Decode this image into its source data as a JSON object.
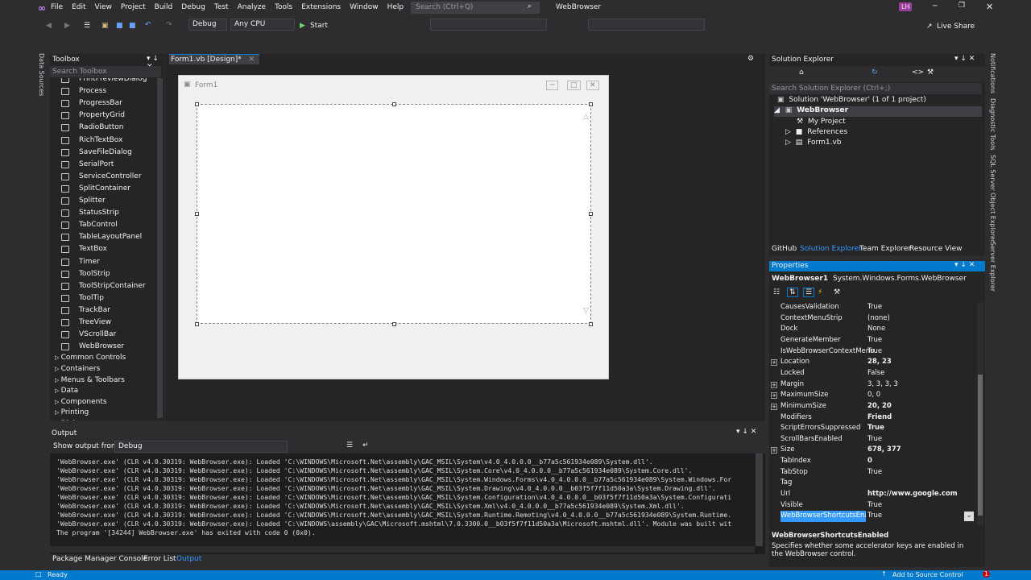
{
  "menu": [
    "File",
    "Edit",
    "View",
    "Project",
    "Build",
    "Debug",
    "Test",
    "Analyze",
    "Tools",
    "Extensions",
    "Window",
    "Help"
  ],
  "search_placeholder": "Search (Ctrl+Q)",
  "window_title": "WebBrowser",
  "user_initials": "LH",
  "toolbar": {
    "config": "Debug",
    "platform": "Any CPU",
    "start": "Start",
    "live_share": "Live Share"
  },
  "toolbox": {
    "title": "Toolbox",
    "search": "Search Toolbox",
    "items": [
      "PrintPreviewDialog",
      "Process",
      "ProgressBar",
      "PropertyGrid",
      "RadioButton",
      "RichTextBox",
      "SaveFileDialog",
      "SerialPort",
      "ServiceController",
      "SplitContainer",
      "Splitter",
      "StatusStrip",
      "TabControl",
      "TableLayoutPanel",
      "TextBox",
      "Timer",
      "ToolStrip",
      "ToolStripContainer",
      "ToolTip",
      "TrackBar",
      "TreeView",
      "VScrollBar",
      "WebBrowser"
    ],
    "categories": [
      "Common Controls",
      "Containers",
      "Menus & Toolbars",
      "Data",
      "Components",
      "Printing",
      "Dialogs"
    ]
  },
  "design_tab": "Form1.vb [Design]*",
  "form_title": "Form1",
  "output": {
    "title": "Output",
    "show_from_label": "Show output from:",
    "source": "Debug",
    "lines": [
      "'WebBrowser.exe' (CLR v4.0.30319: WebBrowser.exe): Loaded 'C:\\WINDOWS\\Microsoft.Net\\assembly\\GAC_MSIL\\System\\v4.0_4.0.0.0__b77a5c561934e089\\System.dll'.",
      "'WebBrowser.exe' (CLR v4.0.30319: WebBrowser.exe): Loaded 'C:\\WINDOWS\\Microsoft.Net\\assembly\\GAC_MSIL\\System.Core\\v4.0_4.0.0.0__b77a5c561934e089\\System.Core.dll'.",
      "'WebBrowser.exe' (CLR v4.0.30319: WebBrowser.exe): Loaded 'C:\\WINDOWS\\Microsoft.Net\\assembly\\GAC_MSIL\\System.Windows.Forms\\v4.0_4.0.0.0__b77a5c561934e089\\System.Windows.For",
      "'WebBrowser.exe' (CLR v4.0.30319: WebBrowser.exe): Loaded 'C:\\WINDOWS\\Microsoft.Net\\assembly\\GAC_MSIL\\System.Drawing\\v4.0_4.0.0.0__b03f5f7f11d50a3a\\System.Drawing.dll'.",
      "'WebBrowser.exe' (CLR v4.0.30319: WebBrowser.exe): Loaded 'C:\\WINDOWS\\Microsoft.Net\\assembly\\GAC_MSIL\\System.Configuration\\v4.0_4.0.0.0__b03f5f7f11d50a3a\\System.Configurati",
      "'WebBrowser.exe' (CLR v4.0.30319: WebBrowser.exe): Loaded 'C:\\WINDOWS\\Microsoft.Net\\assembly\\GAC_MSIL\\System.Xml\\v4.0_4.0.0.0__b77a5c561934e089\\System.Xml.dll'.",
      "'WebBrowser.exe' (CLR v4.0.30319: WebBrowser.exe): Loaded 'C:\\WINDOWS\\Microsoft.Net\\assembly\\GAC_MSIL\\System.Runtime.Remoting\\v4.0_4.0.0.0__b77a5c561934e089\\System.Runtime.",
      "'WebBrowser.exe' (CLR v4.0.30319: WebBrowser.exe): Loaded 'C:\\WINDOWS\\assembly\\GAC\\Microsoft.mshtml\\7.0.3300.0__b03f5f7f11d50a3a\\Microsoft.mshtml.dll'. Module was built wit",
      "The program '[34244] WebBrowser.exe' has exited with code 0 (0x0)."
    ]
  },
  "bottom_tabs": [
    "Package Manager Console",
    "Error List",
    "Output"
  ],
  "solution_explorer": {
    "title": "Solution Explorer",
    "search": "Search Solution Explorer (Ctrl+;)",
    "solution": "Solution 'WebBrowser' (1 of 1 project)",
    "project": "WebBrowser",
    "nodes": [
      "My Project",
      "References",
      "Form1.vb"
    ],
    "tabs": [
      "GitHub",
      "Solution Explorer",
      "Team Explorer",
      "Resource View"
    ]
  },
  "properties": {
    "title": "Properties",
    "object": "WebBrowser1",
    "object_type": "System.Windows.Forms.WebBrowser",
    "rows": [
      {
        "name": "CausesValidation",
        "value": "True",
        "exp": false,
        "bold": false
      },
      {
        "name": "ContextMenuStrip",
        "value": "(none)",
        "exp": false,
        "bold": false
      },
      {
        "name": "Dock",
        "value": "None",
        "exp": false,
        "bold": false
      },
      {
        "name": "GenerateMember",
        "value": "True",
        "exp": false,
        "bold": false
      },
      {
        "name": "IsWebBrowserContextMenu",
        "value": "True",
        "exp": false,
        "bold": false
      },
      {
        "name": "Location",
        "value": "28, 23",
        "exp": true,
        "bold": true
      },
      {
        "name": "Locked",
        "value": "False",
        "exp": false,
        "bold": false
      },
      {
        "name": "Margin",
        "value": "3, 3, 3, 3",
        "exp": true,
        "bold": false
      },
      {
        "name": "MaximumSize",
        "value": "0, 0",
        "exp": true,
        "bold": false
      },
      {
        "name": "MinimumSize",
        "value": "20, 20",
        "exp": true,
        "bold": true
      },
      {
        "name": "Modifiers",
        "value": "Friend",
        "exp": false,
        "bold": true
      },
      {
        "name": "ScriptErrorsSuppressed",
        "value": "True",
        "exp": false,
        "bold": true
      },
      {
        "name": "ScrollBarsEnabled",
        "value": "True",
        "exp": false,
        "bold": false
      },
      {
        "name": "Size",
        "value": "678, 377",
        "exp": true,
        "bold": true
      },
      {
        "name": "TabIndex",
        "value": "0",
        "exp": false,
        "bold": true
      },
      {
        "name": "TabStop",
        "value": "True",
        "exp": false,
        "bold": false
      },
      {
        "name": "Tag",
        "value": "",
        "exp": false,
        "bold": false
      },
      {
        "name": "Url",
        "value": "http://www.google.com",
        "exp": false,
        "bold": true
      },
      {
        "name": "Visible",
        "value": "True",
        "exp": false,
        "bold": false
      },
      {
        "name": "WebBrowserShortcutsEnabl",
        "value": "True",
        "exp": false,
        "bold": false
      }
    ],
    "desc_title": "WebBrowserShortcutsEnabled",
    "desc_text": "Specifies whether some accelerator keys are enabled in the WebBrowser control."
  },
  "side_left": [
    "Data Sources"
  ],
  "side_right": [
    "Notifications",
    "Diagnostic Tools",
    "SQL Server Object Explorer",
    "Server Explorer"
  ],
  "status": {
    "left": "Ready",
    "right": "Add to Source Control"
  }
}
